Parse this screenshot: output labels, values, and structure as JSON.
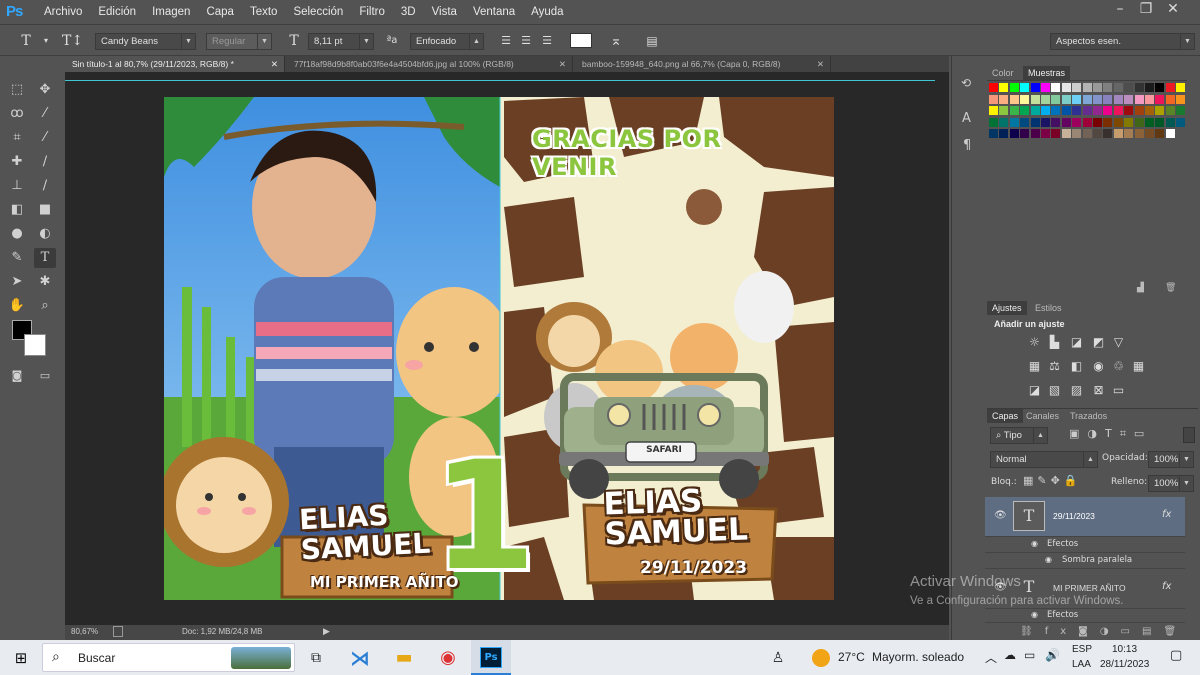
{
  "app": {
    "logo": "Ps"
  },
  "menu": [
    "Archivo",
    "Edición",
    "Imagen",
    "Capa",
    "Texto",
    "Selección",
    "Filtro",
    "3D",
    "Vista",
    "Ventana",
    "Ayuda"
  ],
  "options": {
    "font_family": "Candy Beans",
    "font_style": "Regular",
    "font_size": "8,11 pt",
    "aa_label": "ªa",
    "antialias": "Enfocado",
    "workspace": "Aspectos esen."
  },
  "tabs": [
    {
      "label": "Sin título-1 al 80,7% (29/11/2023, RGB/8) *"
    },
    {
      "label": "77f18af98d9b8f0ab03f6e4a4504bfd6.jpg al 100% (RGB/8)"
    },
    {
      "label": "bamboo-159948_640.png al 66,7% (Capa 0, RGB/8)"
    }
  ],
  "status": {
    "zoom": "80,67%",
    "doc": "Doc: 1,92 MB/24,8 MB"
  },
  "poster": {
    "thanks": "GRACIAS POR VENIR",
    "name_line1": "ELIAS",
    "name_line2": "SAMUEL",
    "subtitle_left": "MI PRIMER AÑITO",
    "number": "1",
    "date": "29/11/2023",
    "safari": "SAFARI"
  },
  "swatch_panel": {
    "tab_color": "Color",
    "tab_samples": "Muestras"
  },
  "adjust_panel": {
    "tab_adjust": "Ajustes",
    "tab_styles": "Estilos",
    "add": "Añadir un ajuste"
  },
  "layers_panel": {
    "tabs": [
      "Capas",
      "Canales",
      "Trazados"
    ],
    "filter": "Tipo",
    "blend": "Normal",
    "opacity_label": "Opacidad:",
    "opacity": "100%",
    "lock_label": "Bloq.:",
    "fill_label": "Relleno:",
    "fill": "100%",
    "layers": [
      {
        "name": "29/11/2023",
        "effects": "Efectos",
        "sub": "Sombra paralela"
      },
      {
        "name": "MI PRIMER AÑITO",
        "effects": "Efectos"
      }
    ],
    "fx": "fx"
  },
  "watermark": {
    "line1": "Activar Windows",
    "line2": "Ve a Configuración para activar Windows."
  },
  "taskbar": {
    "search": "Buscar",
    "weather_temp": "27°C",
    "weather_text": "Mayorm. soleado",
    "lang1": "ESP",
    "lang2": "LAA",
    "time": "10:13",
    "date": "28/11/2023"
  },
  "colors": {
    "accent": "#31a8ff",
    "green": "#8cc63f",
    "giraffe_brown": "#6b3f24",
    "giraffe_cream": "#f3eed0"
  }
}
